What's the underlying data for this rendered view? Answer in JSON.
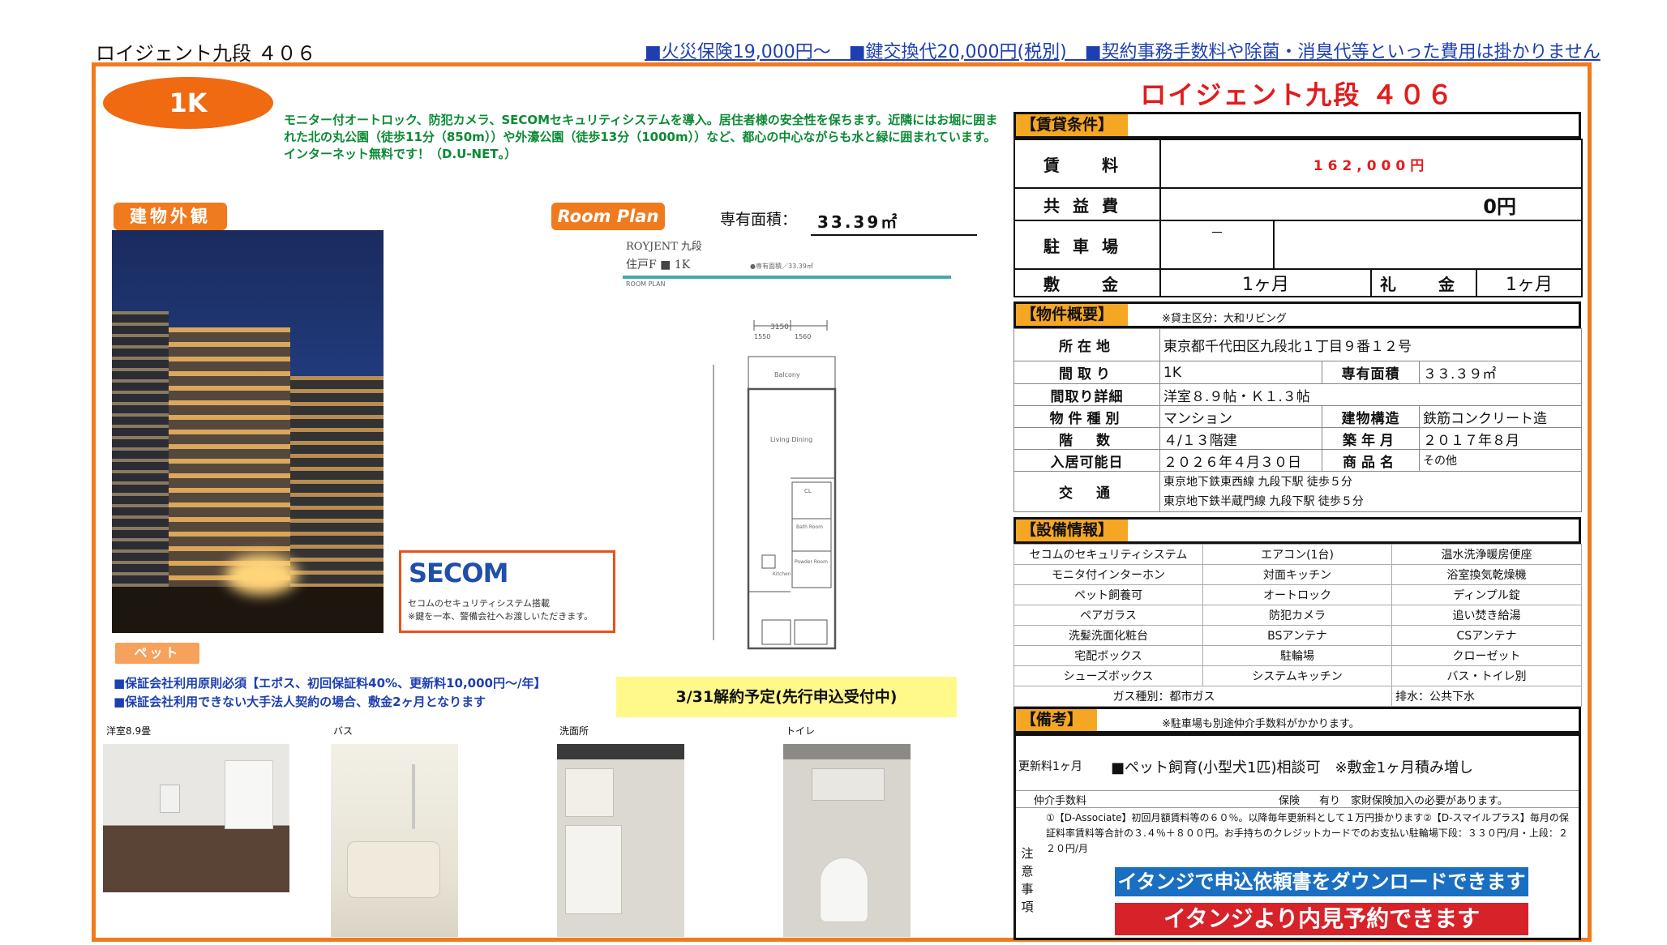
{
  "header": {
    "title": "ロイジェント九段 ４０６",
    "notice": "■火災保険19,000円～　■鍵交換代20,000円(税別)　■契約事務手数料や除菌・消臭代等といった費用は掛かりません"
  },
  "left": {
    "layout_badge": "1K",
    "intro": "モニター付オートロック、防犯カメラ、SECOMセキュリティシステムを導入。居住者様の安全性を保ちます。近隣にはお堀に囲まれた北の丸公園（徒歩11分（850m））や外濠公園（徒歩13分（1000m））など、都心の中心ながらも水と緑に囲まれています。インターネット無料です！（D.U-NET。）",
    "exterior_label": "建物外観",
    "roomplan_label": "Room Plan",
    "area_label": "専有面積：",
    "area_value": "33.39㎡",
    "floorplan": {
      "name": "ROYJENT 九段",
      "type": "住戸F ■ 1K",
      "sub": "ROOM PLAN",
      "note": "●専有面積／33.39㎡",
      "labels": {
        "balcony": "Balcony",
        "living": "Living Dining",
        "cl": "CL",
        "bath": "Bath Room",
        "powder": "Powder Room",
        "kitchen": "Kitchen",
        "dim_w": "3150",
        "dim_a": "1550",
        "dim_b": "1560"
      }
    },
    "secom": {
      "logo": "SECOM",
      "desc": "セコムのセキュリティシステム搭載\n※鍵を一本、警備会社へお渡しいただきます。"
    },
    "pet_label": "ペット",
    "guarantee_1": "■保証会社利用原則必須【エポス、初回保証料40%、更新料10,000円～/年】",
    "guarantee_2": "■保証会社利用できない大手法人契約の場合、敷金2ヶ月となります",
    "notice_yellow": "3/31解約予定(先行申込受付中)",
    "photos": {
      "room": "洋室8.9畳",
      "bath": "バス",
      "wash": "洗面所",
      "toilet": "トイレ"
    }
  },
  "right": {
    "property_title": "ロイジェント九段 ４０６",
    "rent_section": "【賃貸条件】",
    "rent_label": "賃　料",
    "rent_value": "162,000円",
    "common_label": "共益費",
    "common_value": "0円",
    "parking_label": "駐車場",
    "parking_value": "－",
    "deposit_label": "敷　金",
    "deposit_value": "1ヶ月",
    "key_label": "礼　金",
    "key_value": "1ヶ月",
    "overview_section": "【物件概要】",
    "overview_note": "※貸主区分：大和リビング",
    "rows": {
      "address_label": "所在地",
      "address": "東京都千代田区九段北１丁目９番１２号",
      "layout_label": "間取り",
      "layout": "1K",
      "area_label": "専有面積",
      "area": "３３.３９㎡",
      "detail_label": "間取り詳細",
      "detail": "洋室８.９帖・Ｋ１.３帖",
      "type_label": "物件種別",
      "type": "マンション",
      "structure_label": "建物構造",
      "structure": "鉄筋コンクリート造",
      "floor_label": "階　数",
      "floor": "４/１３階建",
      "built_label": "築年月",
      "built": "２０１７年８月",
      "movein_label": "入居可能日",
      "movein": "２０２６年４月３０日",
      "product_label": "商品名",
      "product": "その他",
      "access_label": "交　通",
      "access_1": "東京地下鉄東西線 九段下駅 徒歩５分",
      "access_2": "東京地下鉄半蔵門線 九段下駅 徒歩５分"
    },
    "equip_section": "【設備情報】",
    "equipment": [
      [
        "セコムのセキュリティシステム",
        "エアコン(1台)",
        "温水洗浄暖房便座"
      ],
      [
        "モニタ付インターホン",
        "対面キッチン",
        "浴室換気乾燥機"
      ],
      [
        "ペット飼養可",
        "オートロック",
        "ディンプル錠"
      ],
      [
        "ペアガラス",
        "防犯カメラ",
        "追い焚き給湯"
      ],
      [
        "洗髪洗面化粧台",
        "BSアンテナ",
        "CSアンテナ"
      ],
      [
        "宅配ボックス",
        "駐輪場",
        "クローゼット"
      ],
      [
        "シューズボックス",
        "システムキッチン",
        "バス・トイレ別"
      ]
    ],
    "gas": "ガス種別：都市ガス",
    "drain": "排水：公共下水",
    "remarks_section": "【備考】",
    "remarks_note": "※駐車場も別途仲介手数料がかかります。",
    "renew": "更新料1ヶ月",
    "pet_consult": "■ペット飼育(小型犬1匹)相談可　※敷金1ヶ月積み増し",
    "fee_label": "仲介手数料",
    "ins_label": "保険",
    "ins_value": "有り　家財保険加入の必要があります。",
    "caution_label": "注意事項",
    "caution_text": "①【D-Associate】初回月額賃料等の６０％。以降毎年更新料として１万円掛かります②【D-スマイルプラス】毎月の保証料率賃料等合計の３.４％＋８００円。お手持ちのクレジットカードでのお支払い駐輪場下段：３３０円/月・上段：２２０円/月",
    "btn_download": "イタンジで申込依頼書をダウンロードできます",
    "btn_viewing": "イタンジより内見予約できます"
  }
}
